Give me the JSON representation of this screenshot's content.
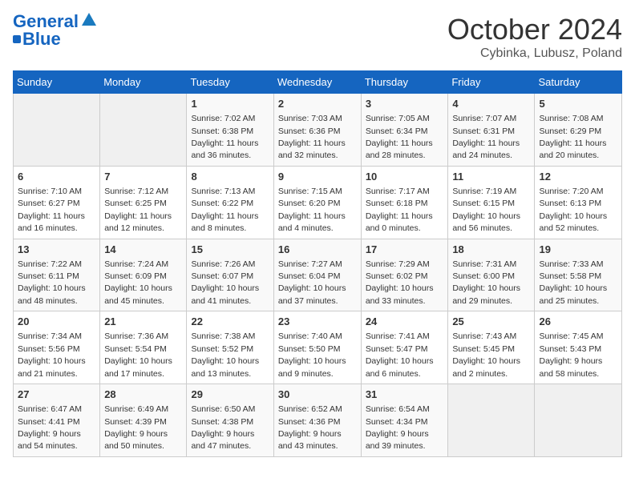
{
  "logo": {
    "line1": "General",
    "line2": "Blue"
  },
  "title": "October 2024",
  "location": "Cybinka, Lubusz, Poland",
  "days_header": [
    "Sunday",
    "Monday",
    "Tuesday",
    "Wednesday",
    "Thursday",
    "Friday",
    "Saturday"
  ],
  "weeks": [
    [
      {
        "day": "",
        "info": ""
      },
      {
        "day": "",
        "info": ""
      },
      {
        "day": "1",
        "info": "Sunrise: 7:02 AM\nSunset: 6:38 PM\nDaylight: 11 hours and 36 minutes."
      },
      {
        "day": "2",
        "info": "Sunrise: 7:03 AM\nSunset: 6:36 PM\nDaylight: 11 hours and 32 minutes."
      },
      {
        "day": "3",
        "info": "Sunrise: 7:05 AM\nSunset: 6:34 PM\nDaylight: 11 hours and 28 minutes."
      },
      {
        "day": "4",
        "info": "Sunrise: 7:07 AM\nSunset: 6:31 PM\nDaylight: 11 hours and 24 minutes."
      },
      {
        "day": "5",
        "info": "Sunrise: 7:08 AM\nSunset: 6:29 PM\nDaylight: 11 hours and 20 minutes."
      }
    ],
    [
      {
        "day": "6",
        "info": "Sunrise: 7:10 AM\nSunset: 6:27 PM\nDaylight: 11 hours and 16 minutes."
      },
      {
        "day": "7",
        "info": "Sunrise: 7:12 AM\nSunset: 6:25 PM\nDaylight: 11 hours and 12 minutes."
      },
      {
        "day": "8",
        "info": "Sunrise: 7:13 AM\nSunset: 6:22 PM\nDaylight: 11 hours and 8 minutes."
      },
      {
        "day": "9",
        "info": "Sunrise: 7:15 AM\nSunset: 6:20 PM\nDaylight: 11 hours and 4 minutes."
      },
      {
        "day": "10",
        "info": "Sunrise: 7:17 AM\nSunset: 6:18 PM\nDaylight: 11 hours and 0 minutes."
      },
      {
        "day": "11",
        "info": "Sunrise: 7:19 AM\nSunset: 6:15 PM\nDaylight: 10 hours and 56 minutes."
      },
      {
        "day": "12",
        "info": "Sunrise: 7:20 AM\nSunset: 6:13 PM\nDaylight: 10 hours and 52 minutes."
      }
    ],
    [
      {
        "day": "13",
        "info": "Sunrise: 7:22 AM\nSunset: 6:11 PM\nDaylight: 10 hours and 48 minutes."
      },
      {
        "day": "14",
        "info": "Sunrise: 7:24 AM\nSunset: 6:09 PM\nDaylight: 10 hours and 45 minutes."
      },
      {
        "day": "15",
        "info": "Sunrise: 7:26 AM\nSunset: 6:07 PM\nDaylight: 10 hours and 41 minutes."
      },
      {
        "day": "16",
        "info": "Sunrise: 7:27 AM\nSunset: 6:04 PM\nDaylight: 10 hours and 37 minutes."
      },
      {
        "day": "17",
        "info": "Sunrise: 7:29 AM\nSunset: 6:02 PM\nDaylight: 10 hours and 33 minutes."
      },
      {
        "day": "18",
        "info": "Sunrise: 7:31 AM\nSunset: 6:00 PM\nDaylight: 10 hours and 29 minutes."
      },
      {
        "day": "19",
        "info": "Sunrise: 7:33 AM\nSunset: 5:58 PM\nDaylight: 10 hours and 25 minutes."
      }
    ],
    [
      {
        "day": "20",
        "info": "Sunrise: 7:34 AM\nSunset: 5:56 PM\nDaylight: 10 hours and 21 minutes."
      },
      {
        "day": "21",
        "info": "Sunrise: 7:36 AM\nSunset: 5:54 PM\nDaylight: 10 hours and 17 minutes."
      },
      {
        "day": "22",
        "info": "Sunrise: 7:38 AM\nSunset: 5:52 PM\nDaylight: 10 hours and 13 minutes."
      },
      {
        "day": "23",
        "info": "Sunrise: 7:40 AM\nSunset: 5:50 PM\nDaylight: 10 hours and 9 minutes."
      },
      {
        "day": "24",
        "info": "Sunrise: 7:41 AM\nSunset: 5:47 PM\nDaylight: 10 hours and 6 minutes."
      },
      {
        "day": "25",
        "info": "Sunrise: 7:43 AM\nSunset: 5:45 PM\nDaylight: 10 hours and 2 minutes."
      },
      {
        "day": "26",
        "info": "Sunrise: 7:45 AM\nSunset: 5:43 PM\nDaylight: 9 hours and 58 minutes."
      }
    ],
    [
      {
        "day": "27",
        "info": "Sunrise: 6:47 AM\nSunset: 4:41 PM\nDaylight: 9 hours and 54 minutes."
      },
      {
        "day": "28",
        "info": "Sunrise: 6:49 AM\nSunset: 4:39 PM\nDaylight: 9 hours and 50 minutes."
      },
      {
        "day": "29",
        "info": "Sunrise: 6:50 AM\nSunset: 4:38 PM\nDaylight: 9 hours and 47 minutes."
      },
      {
        "day": "30",
        "info": "Sunrise: 6:52 AM\nSunset: 4:36 PM\nDaylight: 9 hours and 43 minutes."
      },
      {
        "day": "31",
        "info": "Sunrise: 6:54 AM\nSunset: 4:34 PM\nDaylight: 9 hours and 39 minutes."
      },
      {
        "day": "",
        "info": ""
      },
      {
        "day": "",
        "info": ""
      }
    ]
  ]
}
